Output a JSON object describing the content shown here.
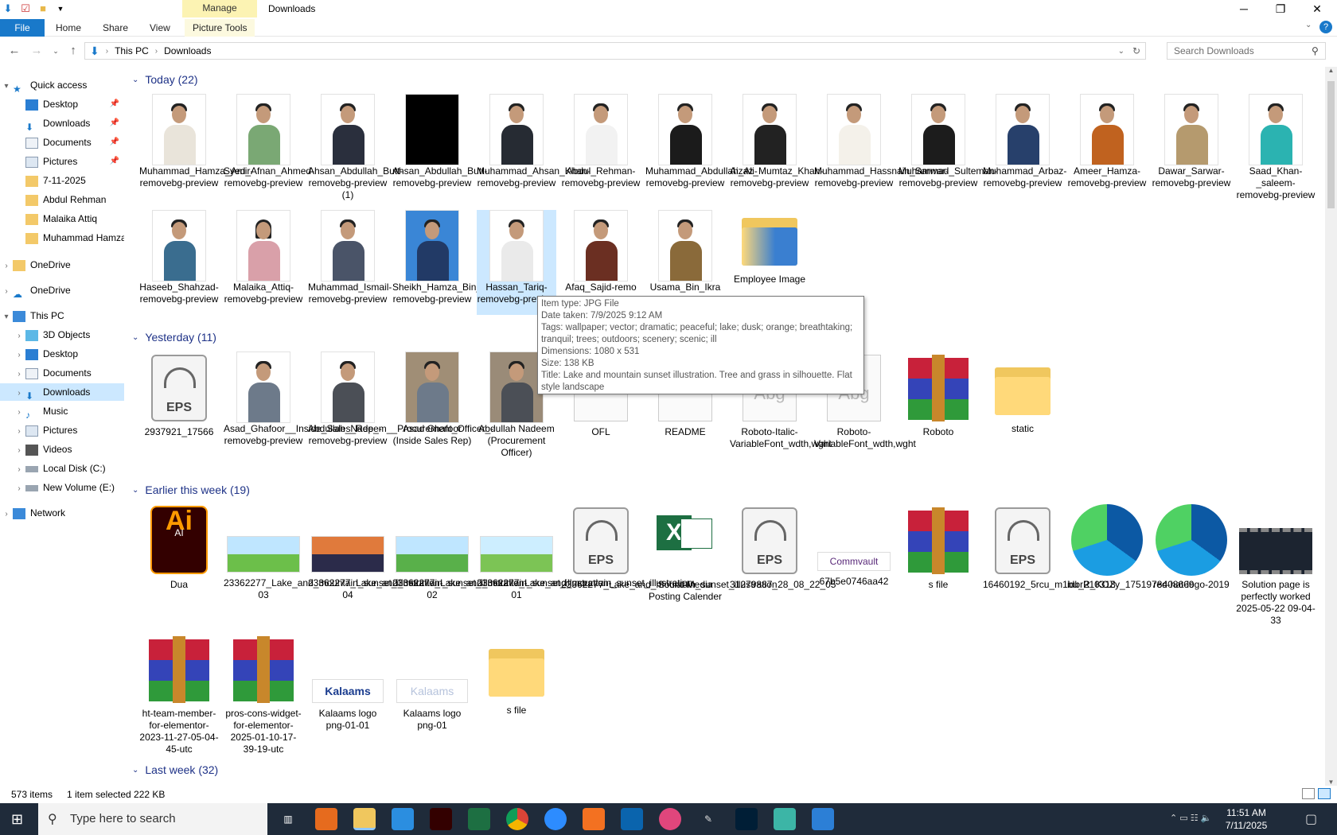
{
  "window": {
    "title": "Downloads",
    "contextual_tab": "Manage",
    "controls": {
      "minimize": "─",
      "maximize": "❐",
      "close": "✕"
    }
  },
  "ribbon": {
    "tabs": [
      "File",
      "Home",
      "Share",
      "View",
      "Picture Tools"
    ]
  },
  "address": {
    "path": [
      "This PC",
      "Downloads"
    ],
    "search_placeholder": "Search Downloads"
  },
  "sidebar": {
    "quick_access": "Quick access",
    "quick_items": [
      "Desktop",
      "Downloads",
      "Documents",
      "Pictures",
      "7-11-2025",
      "Abdul Rehman",
      "Malaika Attiq",
      "Muhammad Hamza"
    ],
    "onedrive1": "OneDrive",
    "onedrive2": "OneDrive",
    "this_pc": "This PC",
    "pc_items": [
      "3D Objects",
      "Desktop",
      "Documents",
      "Downloads",
      "Music",
      "Pictures",
      "Videos",
      "Local Disk (C:)",
      "New Volume (E:)"
    ],
    "network": "Network"
  },
  "groups": {
    "today": "Today (22)",
    "yesterday": "Yesterday (11)",
    "earlier": "Earlier this week (19)",
    "last_week": "Last week (32)"
  },
  "today_items": [
    "Muhammad_Hamza_Amir-removebg-preview",
    "Syed_Afnan_Ahmed-removebg-preview",
    "Ahsan_Abdullah_Butt-removebg-preview (1)",
    "Ahsan_Abdullah_Butt-removebg-preview",
    "Muhammad_Ahsan_Khan-removebg-preview",
    "Abdul_Rehman-removebg-preview",
    "Muhammad_Abdullah_Ali-removebg-preview",
    "Aizaz_Mumtaz_Khan-removebg-preview",
    "Muhammad_Hassnain_Sarwar-removebg-preview",
    "Muhammad_Sulteman-removebg-preview",
    "Muhammad_Arbaz-removebg-preview",
    "Ameer_Hamza-removebg-preview",
    "Dawar_Sarwar-removebg-preview",
    "Saad_Khan-_saleem-removebg-preview",
    "Haseeb_Shahzad-removebg-preview",
    "Malaika_Attiq-removebg-preview",
    "Muhammad_Ismail-removebg-preview",
    "Sheikh_Hamza_Bin_Sohail-removebg-preview",
    "Hassan_Tariq-removebg-preview",
    "Afaq_Sajid-remo",
    "Usama_Bin_Ikra",
    "Employee Image"
  ],
  "yesterday_items": [
    "2937921_17566",
    "Asad_Ghafoor__Inside_Sales_Rep_-removebg-preview",
    "Abdullah_Nadeem__Procurement_Officer_-removebg-preview",
    "Asad Ghafoor (Inside Sales Rep)",
    "Abdullah Nadeem (Procurement Officer)",
    "OFL",
    "README",
    "Roboto-Italic-VariableFont_wdth,wght",
    "Roboto-VariableFont_wdth,wght",
    "Roboto",
    "static"
  ],
  "earlier_items": [
    "Dua",
    "23362277_Lake_and_mountain_sunset_illustration-03",
    "23362277_Lake_and_mountain_sunset_illustration-04",
    "23362277_Lake_and_mountain_sunset_illustration-02",
    "23362277_Lake_and_mountain_sunset_illustration-01",
    "23362277_Lake_and_mountain_sunset_illustration",
    "Social Media Posting Calender",
    "31279887_28_08_22_05",
    "67b5e0746aa42",
    "s file",
    "16460192_5rcu_m1bu_210318",
    "idbrR_KOZy_1751978408669",
    "red-hat-logo-2019",
    "Solution page is perfectly worked 2025-05-22 09-04-33",
    "ht-team-member-for-elementor-2023-11-27-05-04-45-utc",
    "pros-cons-widget-for-elementor-2025-01-10-17-39-19-utc",
    "Kalaams logo png-01-01",
    "Kalaams logo png-01",
    "s file"
  ],
  "labels": {
    "eps": "EPS",
    "ai": "Ai",
    "ai_small": "AI",
    "excel": "X",
    "commvault": "Commvault",
    "kalaams": "Kalaams",
    "abg": "Abg"
  },
  "tooltip": {
    "type": "Item type: JPG File",
    "date": "Date taken: 7/9/2025 9:12 AM",
    "tags": "Tags: wallpaper; vector; dramatic; peaceful; lake; dusk; orange; breathtaking; tranquil; trees; outdoors; scenery; scenic; ill",
    "dimensions": "Dimensions: 1080 x 531",
    "size": "Size: 138 KB",
    "title": "Title: Lake and mountain sunset illustration. Tree and grass in silhouette. Flat style landscape"
  },
  "status": {
    "count": "573 items",
    "selected": "1 item selected  222 KB"
  },
  "taskbar": {
    "search_placeholder": "Type here to search",
    "time": "11:51 AM",
    "date": "7/11/2025"
  },
  "colors": {
    "accent": "#1979ca",
    "group_header": "#1e3287",
    "selection": "#cce8ff",
    "manage_tab": "#fcf3b3",
    "taskbar": "#1f2b3a"
  }
}
